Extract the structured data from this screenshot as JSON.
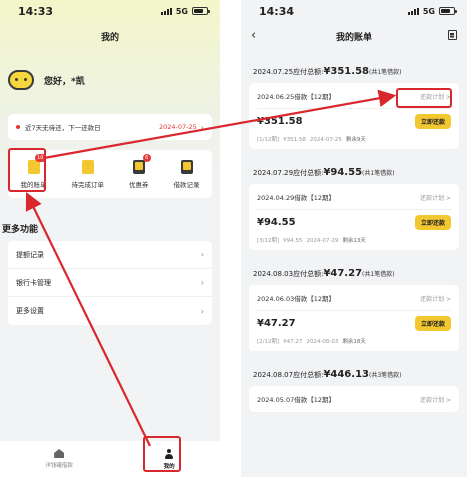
{
  "left": {
    "status": {
      "time": "14:33",
      "network": "5G"
    },
    "title": "我的",
    "greeting": "您好，*凯",
    "notice": {
      "text": "近7天无待还，下一还款日",
      "date": "2024-07-25"
    },
    "quick": [
      {
        "label": "我的账单",
        "badge": "10",
        "icon": "bill-icon"
      },
      {
        "label": "待完成订单",
        "badge": "",
        "icon": "order-icon"
      },
      {
        "label": "优惠券",
        "badge": "6",
        "icon": "coupon-icon"
      },
      {
        "label": "借款记录",
        "badge": "",
        "icon": "record-icon"
      }
    ],
    "more_title": "更多功能",
    "menu": [
      {
        "label": "提额记录"
      },
      {
        "label": "银行卡管理"
      },
      {
        "label": "更多设置"
      }
    ],
    "tabs": [
      {
        "label": "洋钱罐借款"
      },
      {
        "label": "我的"
      }
    ]
  },
  "right": {
    "status": {
      "time": "14:34",
      "network": "5G"
    },
    "title": "我的账单",
    "groups": [
      {
        "due_prefix": "2024.07.25应付总额:",
        "due_amount": "¥351.58",
        "due_count": "(共1笔借款)",
        "loan": "2024.06.25借款【12期】",
        "plan": "还款计划 >",
        "amount": "¥351.58",
        "pay": "立即还款",
        "term": "[1/12期]",
        "meta_amount": "¥351.58",
        "meta_date": "2024-07-25",
        "remain": "剩余9天"
      },
      {
        "due_prefix": "2024.07.29应付总额:",
        "due_amount": "¥94.55",
        "due_count": "(共1笔借款)",
        "loan": "2024.04.29借款【12期】",
        "plan": "还款计划 >",
        "amount": "¥94.55",
        "pay": "立即还款",
        "term": "[3/12期]",
        "meta_amount": "¥94.55",
        "meta_date": "2024-07-29",
        "remain": "剩余13天"
      },
      {
        "due_prefix": "2024.08.03应付总额:",
        "due_amount": "¥47.27",
        "due_count": "(共1笔借款)",
        "loan": "2024.06.03借款【12期】",
        "plan": "还款计划 >",
        "amount": "¥47.27",
        "pay": "立即还款",
        "term": "[2/12期]",
        "meta_amount": "¥47.27",
        "meta_date": "2024-08-03",
        "remain": "剩余18天"
      },
      {
        "due_prefix": "2024.08.07应付总额:",
        "due_amount": "¥446.13",
        "due_count": "(共3笔借款)",
        "loan": "2024.05.07借款【12期】",
        "plan": "还款计划 >"
      }
    ]
  },
  "colors": {
    "accent": "#f3c730",
    "highlight": "#d9272e"
  }
}
